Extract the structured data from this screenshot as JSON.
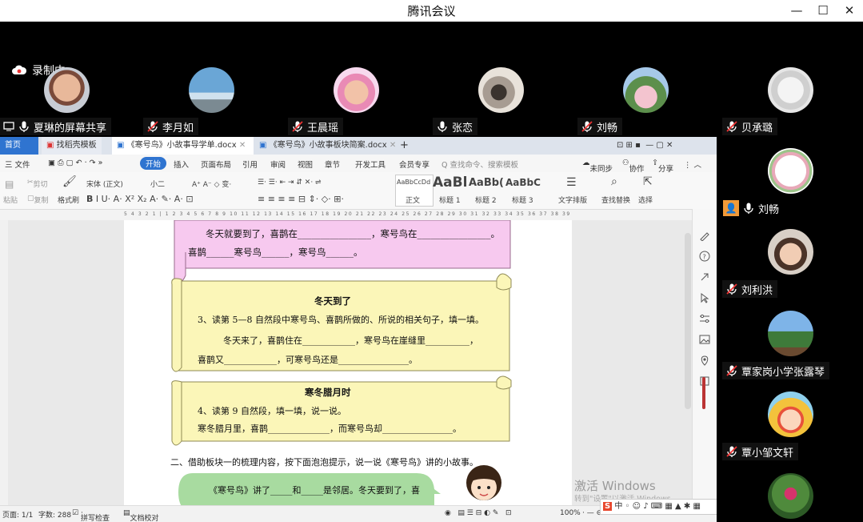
{
  "window": {
    "title": "腾讯会议",
    "minimize": "—",
    "maximize": "☐",
    "close": "✕"
  },
  "recording": {
    "label": "录制中"
  },
  "participants": [
    {
      "name": "夏琳的屏幕共享",
      "muted": false
    },
    {
      "name": "李月如",
      "muted": true
    },
    {
      "name": "王晨瑶",
      "muted": true
    },
    {
      "name": "张恋",
      "muted": false
    },
    {
      "name": "刘畅",
      "muted": true
    },
    {
      "name": "贝承璐",
      "muted": true
    },
    {
      "name": "刘畅",
      "muted": false
    },
    {
      "name": "刘利洪",
      "muted": true
    },
    {
      "name": "覃家岗小学张露琴",
      "muted": true
    },
    {
      "name": "覃小邹文轩",
      "muted": true
    }
  ],
  "wps": {
    "tabs": [
      "首页",
      "找稻壳模板",
      "《寒号鸟》小故事导学单.docx",
      "《寒号鸟》小故事板块简案.docx"
    ],
    "menu_file": "三 文件",
    "menus": [
      "开始",
      "插入",
      "页面布局",
      "引用",
      "审阅",
      "视图",
      "章节",
      "开发工具",
      "会员专享"
    ],
    "search_placeholder": "Q 查找命令、搜索模板",
    "sync": "未同步",
    "collab": "协作",
    "share": "分享",
    "ribbon": {
      "cut": "剪切",
      "paste": "粘贴",
      "copy": "复制",
      "format_painter": "格式刷",
      "font": "宋体 (正文)",
      "size": "小二",
      "styles": [
        "AaBbCcDd",
        "AaBl",
        "AaBb(",
        "AaBbC"
      ],
      "style_names": [
        "正文",
        "标题 1",
        "标题 2",
        "标题 3"
      ],
      "text_layout": "文字排版",
      "find_replace": "查找替换",
      "select": "选择"
    },
    "ruler": "5 4 3 2 1 | 1 2 3 4 5 6 7 8 9 10 11 12 13 14 15 16 17 18 19 20 21 22 23 24 25 26 27 28 29 30 31 32 33 34 35 36 37 38 39 40 41 42 43 44 45 46 47 48 49 50",
    "status": {
      "page": "页面: 1/1",
      "words": "字数: 288",
      "spell": "拼写检查",
      "proof": "文档校对",
      "zoom": "100%"
    }
  },
  "document": {
    "line_top": "冬天就要到了，喜鹊在________________，寒号鸟在________________。",
    "line_top2": "喜鹊______寒号鸟______，寒号鸟______。",
    "heading1": "冬天到了",
    "q3": "3、读第 5—8 自然段中寒号鸟、喜鹊所做的、所说的相关句子，填一填。",
    "q3_line1": "冬天来了，喜鹊住在____________，寒号鸟在崖缝里__________，",
    "q3_line2": "喜鹊又____________，可寒号鸟还是________________。",
    "heading2": "寒冬腊月时",
    "q4": "4、读第 9 自然段，填一填，说一说。",
    "q4_line": "寒冬腊月里，喜鹊______________，而寒号鸟却________________。",
    "section2": "二、借助板块一的梳理内容，按下面泡泡提示，说一说《寒号鸟》讲的小故事。",
    "bubble": "《寒号鸟》讲了_____和_____是邻居。冬天要到了，喜"
  },
  "watermark": {
    "line1": "激活 Windows",
    "line2": "转到\"设置\"以激活 Windows。"
  },
  "colors": {
    "pink_scroll": "#f7c9ef",
    "yellow_scroll": "#fbf6b8",
    "bubble": "#a8dba0",
    "accent": "#2f74d0"
  }
}
